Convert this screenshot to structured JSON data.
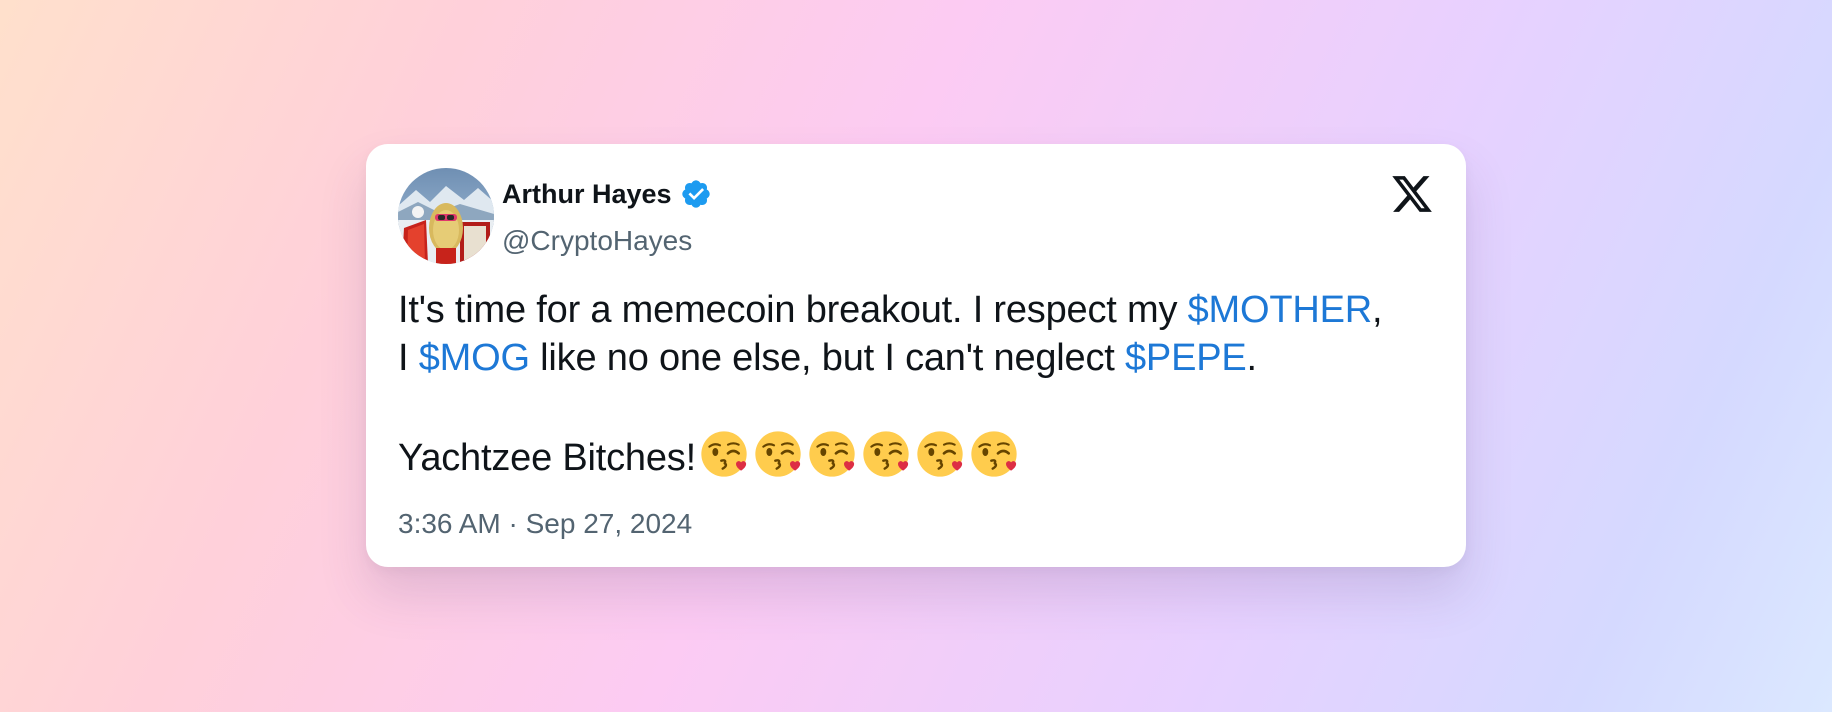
{
  "tweet": {
    "author": {
      "display_name": "Arthur Hayes",
      "handle": "@CryptoHayes",
      "verified": true,
      "verified_icon": "verified-badge-icon",
      "verified_color": "#1d9bf0"
    },
    "platform_icon": "x-logo-icon",
    "text": {
      "line1_a": "It's time for a memecoin breakout. I respect my ",
      "cashtag1": "$MOTHER",
      "line1_b": ",",
      "line2_a": "I ",
      "cashtag2": "$MOG",
      "line2_b": " like no one else, but I can't neglect ",
      "cashtag3": "$PEPE",
      "line2_c": ".",
      "line3": "Yachtzee Bitches!"
    },
    "emoji": {
      "name": "face-blowing-a-kiss-icon",
      "count": 6
    },
    "timestamp": "3:36 AM · Sep 27, 2024"
  },
  "colors": {
    "text": "#0f1419",
    "secondary_text": "#536471",
    "cashtag": "#1d78d6",
    "card_background": "#ffffff"
  }
}
